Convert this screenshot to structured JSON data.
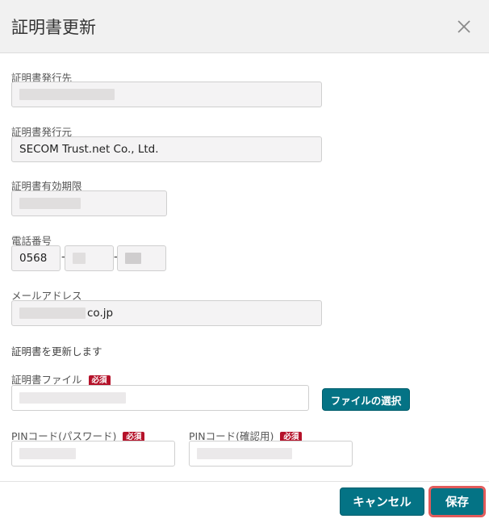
{
  "dialog": {
    "title": "証明書更新",
    "close_icon": "close-icon"
  },
  "form": {
    "issued_to": {
      "label": "証明書発行先",
      "value": ""
    },
    "issuer": {
      "label": "証明書発行元",
      "value": "SECOM Trust.net Co., Ltd."
    },
    "expiry": {
      "label": "証明書有効期限",
      "value": ""
    },
    "phone": {
      "label": "電話番号",
      "part1": "0568",
      "part2": "",
      "part3": "",
      "separator": "-"
    },
    "email": {
      "label": "メールアドレス",
      "value_suffix": "co.jp"
    },
    "note": "証明書を更新します",
    "cert_file": {
      "label": "証明書ファイル",
      "required_badge": "必須",
      "select_button": "ファイルの選択"
    },
    "pin": {
      "label": "PINコード(パスワード)",
      "required_badge": "必須"
    },
    "pin_confirm": {
      "label": "PINコード(確認用)",
      "required_badge": "必須"
    }
  },
  "footer": {
    "cancel_label": "キャンセル",
    "save_label": "保存"
  },
  "colors": {
    "primary": "#047385",
    "required": "#b5122a",
    "highlight": "#e25a5a"
  }
}
